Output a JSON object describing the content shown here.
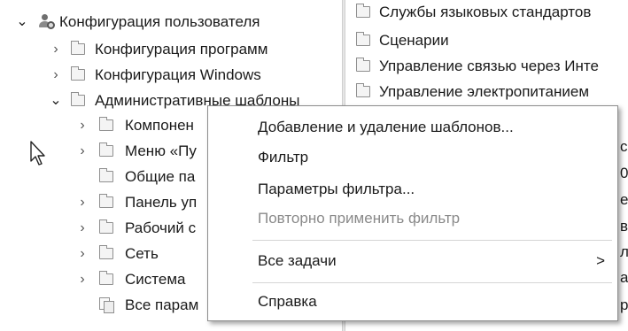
{
  "tree": {
    "root": {
      "label": "Конфигурация пользователя"
    },
    "items": [
      {
        "label": "Конфигурация программ"
      },
      {
        "label": "Конфигурация Windows"
      },
      {
        "label": "Административные шаблоны"
      },
      {
        "label": "Компонен"
      },
      {
        "label": "Меню «Пу"
      },
      {
        "label": "Общие па"
      },
      {
        "label": "Панель уп"
      },
      {
        "label": "Рабочий с"
      },
      {
        "label": "Сеть"
      },
      {
        "label": "Система"
      },
      {
        "label": "Все парам"
      }
    ]
  },
  "right_list": {
    "items": [
      {
        "label": "Службы языковых стандартов"
      },
      {
        "label": "Сценарии"
      },
      {
        "label": "Управление связью через Инте"
      },
      {
        "label": "Управление электропитанием"
      }
    ],
    "edge_chars": [
      "с",
      "0",
      "е",
      "в",
      "л",
      "а",
      "р"
    ]
  },
  "context_menu": {
    "items": [
      {
        "label": "Добавление и удаление шаблонов..."
      },
      {
        "label": "Фильтр"
      },
      {
        "label": "Параметры фильтра..."
      },
      {
        "label": "Повторно применить фильтр"
      },
      {
        "label": "Все задачи",
        "submenu_arrow": ">"
      },
      {
        "label": "Справка"
      }
    ]
  }
}
